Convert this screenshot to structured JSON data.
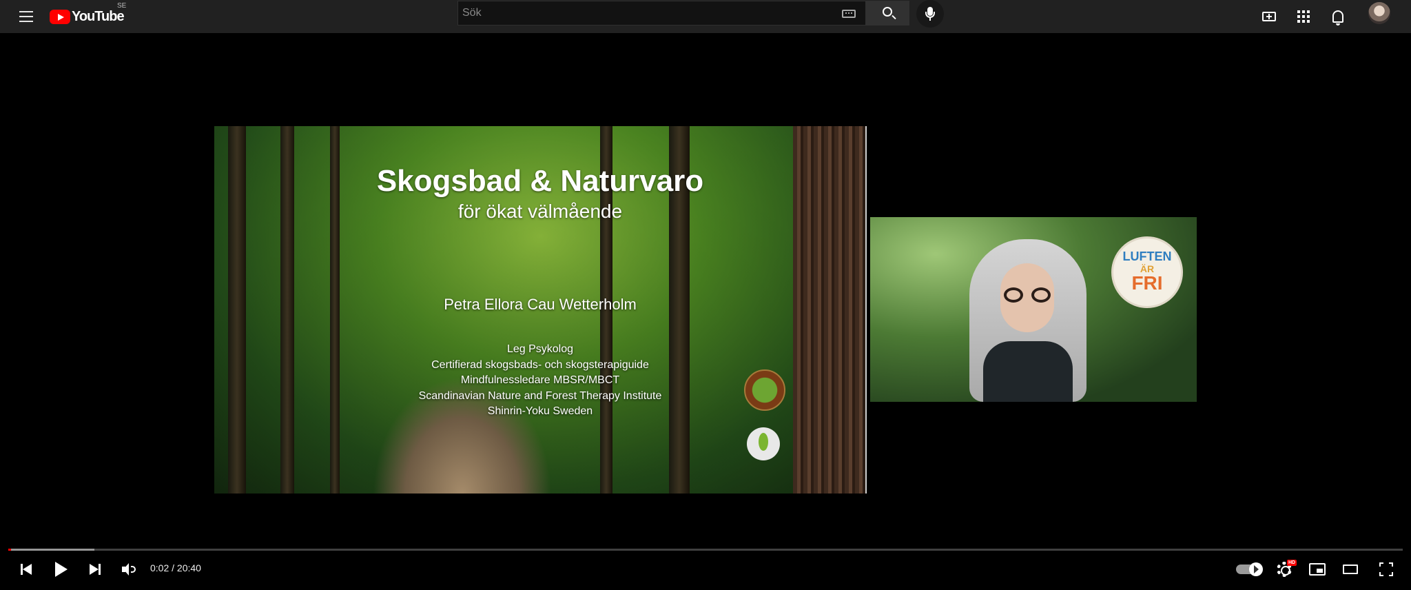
{
  "masthead": {
    "logo_text": "YouTube",
    "country_code": "SE",
    "search_placeholder": "Sök",
    "icons": [
      "menu-icon",
      "keyboard-icon",
      "search-icon",
      "mic-icon",
      "create-icon",
      "apps-icon",
      "bell-icon"
    ]
  },
  "slide": {
    "title": "Skogsbad & Naturvaro",
    "subtitle": "för ökat välmående",
    "author": "Petra Ellora Cau Wetterholm",
    "credentials": [
      "Leg Psykolog",
      "Certifierad skogsbads- och skogsterapiguide",
      "Mindfulnessledare MBSR/MBCT",
      "Scandinavian Nature and Forest Therapy Institute",
      "Shinrin-Yoku Sweden"
    ]
  },
  "webcam_badge": {
    "top": "LUFTEN",
    "middle": "ÄR",
    "main": "FRI"
  },
  "player": {
    "time_display": "0:02 / 20:40",
    "played_fraction": 0.002,
    "loaded_fraction": 0.062,
    "hd_badge": "HD",
    "accent_color": "#ff0000"
  }
}
